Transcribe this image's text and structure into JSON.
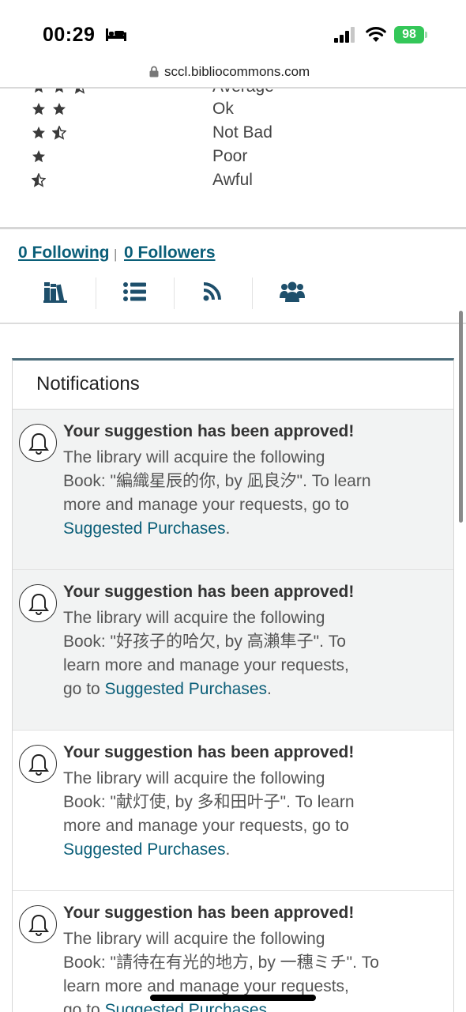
{
  "status_bar": {
    "time": "00:29",
    "battery": "98",
    "icons": [
      "bed-icon",
      "cellular-signal-icon",
      "wifi-icon",
      "battery-icon"
    ]
  },
  "url_bar": {
    "url": "sccl.bibliocommons.com",
    "icon": "lock-icon"
  },
  "ratings": [
    {
      "label": "Average",
      "stars": 2.5
    },
    {
      "label": "Ok",
      "stars": 2
    },
    {
      "label": "Not Bad",
      "stars": 1.5
    },
    {
      "label": "Poor",
      "stars": 1
    },
    {
      "label": "Awful",
      "stars": 0.5
    }
  ],
  "follow": {
    "following": "0 Following",
    "separator": "|",
    "followers": "0 Followers"
  },
  "tabs": [
    {
      "icon": "books-icon"
    },
    {
      "icon": "list-icon"
    },
    {
      "icon": "rss-icon"
    },
    {
      "icon": "users-icon"
    }
  ],
  "notifications": {
    "title": "Notifications",
    "items": [
      {
        "title": "Your suggestion has been approved!",
        "body_lines": [
          "The library will acquire the following",
          "Book: \"編織星辰的你, by 凪良汐\". To learn",
          "more and manage your requests, go to"
        ],
        "link": "Suggested Purchases",
        "suffix": ".",
        "shaded": true
      },
      {
        "title": "Your suggestion has been approved!",
        "body_lines": [
          "The library will acquire the following",
          "Book: \"好孩子的哈欠, by 高瀨隼子\". To",
          "learn more and manage your requests,"
        ],
        "prefix": "go to ",
        "link": "Suggested Purchases",
        "suffix": ".",
        "shaded": true
      },
      {
        "title": "Your suggestion has been approved!",
        "body_lines": [
          "The library will acquire the following",
          "Book: \"献灯使, by 多和田叶子\". To learn",
          "more and manage your requests, go to"
        ],
        "link": "Suggested Purchases",
        "suffix": ".",
        "shaded": false
      },
      {
        "title": "Your suggestion has been approved!",
        "body_lines": [
          "The library will acquire the following",
          "Book: \"請待在有光的地方, by 一穗ミチ\". To",
          "learn more and manage your requests,"
        ],
        "prefix": "go to ",
        "link": "Suggested Purchases",
        "suffix": ".",
        "shaded": false
      }
    ]
  },
  "colors": {
    "link": "#0a5e78",
    "panel_accent": "#4b6c7a",
    "battery": "#34c759",
    "shade": "#f2f3f3"
  }
}
